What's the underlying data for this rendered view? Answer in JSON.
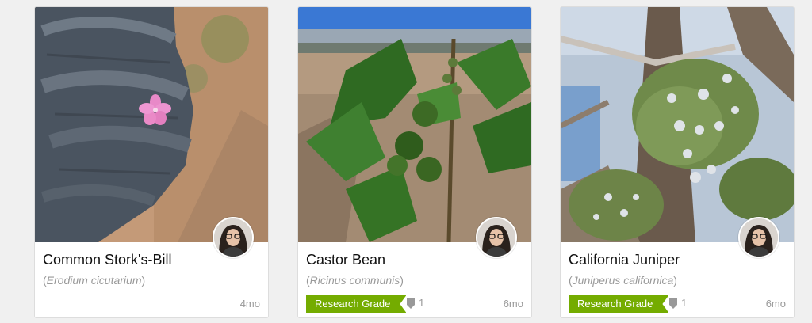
{
  "observations": [
    {
      "common_name": "Common Stork's-Bill",
      "scientific_name": "Erodium cicutarium",
      "quality_grade": "",
      "identifications": "",
      "age": "4mo",
      "photo": "pink stork's-bill flower held in gloved hand",
      "avatar": "observer-avatar"
    },
    {
      "common_name": "Castor Bean",
      "scientific_name": "Ricinus communis",
      "quality_grade": "Research Grade",
      "identifications": "1",
      "age": "6mo",
      "photo": "castor bean plant with spiny seed capsules",
      "avatar": "observer-avatar"
    },
    {
      "common_name": "California Juniper",
      "scientific_name": "Juniperus californica",
      "quality_grade": "Research Grade",
      "identifications": "1",
      "age": "6mo",
      "photo": "juniper branches with pale blue berries",
      "avatar": "observer-avatar"
    }
  ],
  "colors": {
    "research_grade": "#74ac00",
    "muted_text": "#999999",
    "card_border": "#dddddd"
  }
}
